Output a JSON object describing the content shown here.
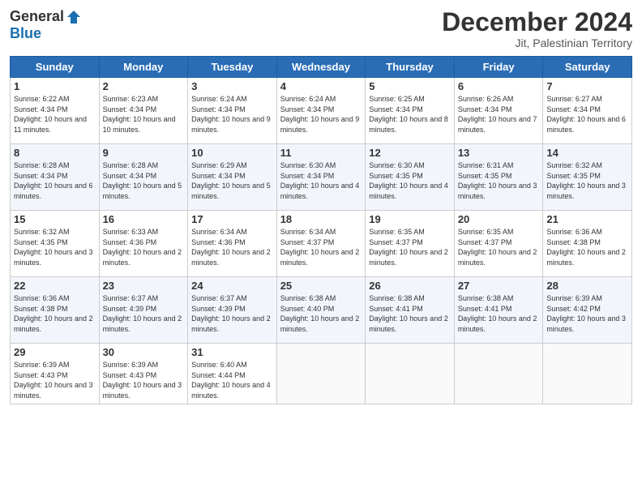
{
  "header": {
    "logo_general": "General",
    "logo_blue": "Blue",
    "month_year": "December 2024",
    "location": "Jit, Palestinian Territory"
  },
  "days_of_week": [
    "Sunday",
    "Monday",
    "Tuesday",
    "Wednesday",
    "Thursday",
    "Friday",
    "Saturday"
  ],
  "weeks": [
    [
      {
        "day": "1",
        "sunrise": "6:22 AM",
        "sunset": "4:34 PM",
        "daylight": "10 hours and 11 minutes."
      },
      {
        "day": "2",
        "sunrise": "6:23 AM",
        "sunset": "4:34 PM",
        "daylight": "10 hours and 10 minutes."
      },
      {
        "day": "3",
        "sunrise": "6:24 AM",
        "sunset": "4:34 PM",
        "daylight": "10 hours and 9 minutes."
      },
      {
        "day": "4",
        "sunrise": "6:24 AM",
        "sunset": "4:34 PM",
        "daylight": "10 hours and 9 minutes."
      },
      {
        "day": "5",
        "sunrise": "6:25 AM",
        "sunset": "4:34 PM",
        "daylight": "10 hours and 8 minutes."
      },
      {
        "day": "6",
        "sunrise": "6:26 AM",
        "sunset": "4:34 PM",
        "daylight": "10 hours and 7 minutes."
      },
      {
        "day": "7",
        "sunrise": "6:27 AM",
        "sunset": "4:34 PM",
        "daylight": "10 hours and 6 minutes."
      }
    ],
    [
      {
        "day": "8",
        "sunrise": "6:28 AM",
        "sunset": "4:34 PM",
        "daylight": "10 hours and 6 minutes."
      },
      {
        "day": "9",
        "sunrise": "6:28 AM",
        "sunset": "4:34 PM",
        "daylight": "10 hours and 5 minutes."
      },
      {
        "day": "10",
        "sunrise": "6:29 AM",
        "sunset": "4:34 PM",
        "daylight": "10 hours and 5 minutes."
      },
      {
        "day": "11",
        "sunrise": "6:30 AM",
        "sunset": "4:34 PM",
        "daylight": "10 hours and 4 minutes."
      },
      {
        "day": "12",
        "sunrise": "6:30 AM",
        "sunset": "4:35 PM",
        "daylight": "10 hours and 4 minutes."
      },
      {
        "day": "13",
        "sunrise": "6:31 AM",
        "sunset": "4:35 PM",
        "daylight": "10 hours and 3 minutes."
      },
      {
        "day": "14",
        "sunrise": "6:32 AM",
        "sunset": "4:35 PM",
        "daylight": "10 hours and 3 minutes."
      }
    ],
    [
      {
        "day": "15",
        "sunrise": "6:32 AM",
        "sunset": "4:35 PM",
        "daylight": "10 hours and 3 minutes."
      },
      {
        "day": "16",
        "sunrise": "6:33 AM",
        "sunset": "4:36 PM",
        "daylight": "10 hours and 2 minutes."
      },
      {
        "day": "17",
        "sunrise": "6:34 AM",
        "sunset": "4:36 PM",
        "daylight": "10 hours and 2 minutes."
      },
      {
        "day": "18",
        "sunrise": "6:34 AM",
        "sunset": "4:37 PM",
        "daylight": "10 hours and 2 minutes."
      },
      {
        "day": "19",
        "sunrise": "6:35 AM",
        "sunset": "4:37 PM",
        "daylight": "10 hours and 2 minutes."
      },
      {
        "day": "20",
        "sunrise": "6:35 AM",
        "sunset": "4:37 PM",
        "daylight": "10 hours and 2 minutes."
      },
      {
        "day": "21",
        "sunrise": "6:36 AM",
        "sunset": "4:38 PM",
        "daylight": "10 hours and 2 minutes."
      }
    ],
    [
      {
        "day": "22",
        "sunrise": "6:36 AM",
        "sunset": "4:38 PM",
        "daylight": "10 hours and 2 minutes."
      },
      {
        "day": "23",
        "sunrise": "6:37 AM",
        "sunset": "4:39 PM",
        "daylight": "10 hours and 2 minutes."
      },
      {
        "day": "24",
        "sunrise": "6:37 AM",
        "sunset": "4:39 PM",
        "daylight": "10 hours and 2 minutes."
      },
      {
        "day": "25",
        "sunrise": "6:38 AM",
        "sunset": "4:40 PM",
        "daylight": "10 hours and 2 minutes."
      },
      {
        "day": "26",
        "sunrise": "6:38 AM",
        "sunset": "4:41 PM",
        "daylight": "10 hours and 2 minutes."
      },
      {
        "day": "27",
        "sunrise": "6:38 AM",
        "sunset": "4:41 PM",
        "daylight": "10 hours and 2 minutes."
      },
      {
        "day": "28",
        "sunrise": "6:39 AM",
        "sunset": "4:42 PM",
        "daylight": "10 hours and 3 minutes."
      }
    ],
    [
      {
        "day": "29",
        "sunrise": "6:39 AM",
        "sunset": "4:43 PM",
        "daylight": "10 hours and 3 minutes."
      },
      {
        "day": "30",
        "sunrise": "6:39 AM",
        "sunset": "4:43 PM",
        "daylight": "10 hours and 3 minutes."
      },
      {
        "day": "31",
        "sunrise": "6:40 AM",
        "sunset": "4:44 PM",
        "daylight": "10 hours and 4 minutes."
      },
      null,
      null,
      null,
      null
    ]
  ]
}
